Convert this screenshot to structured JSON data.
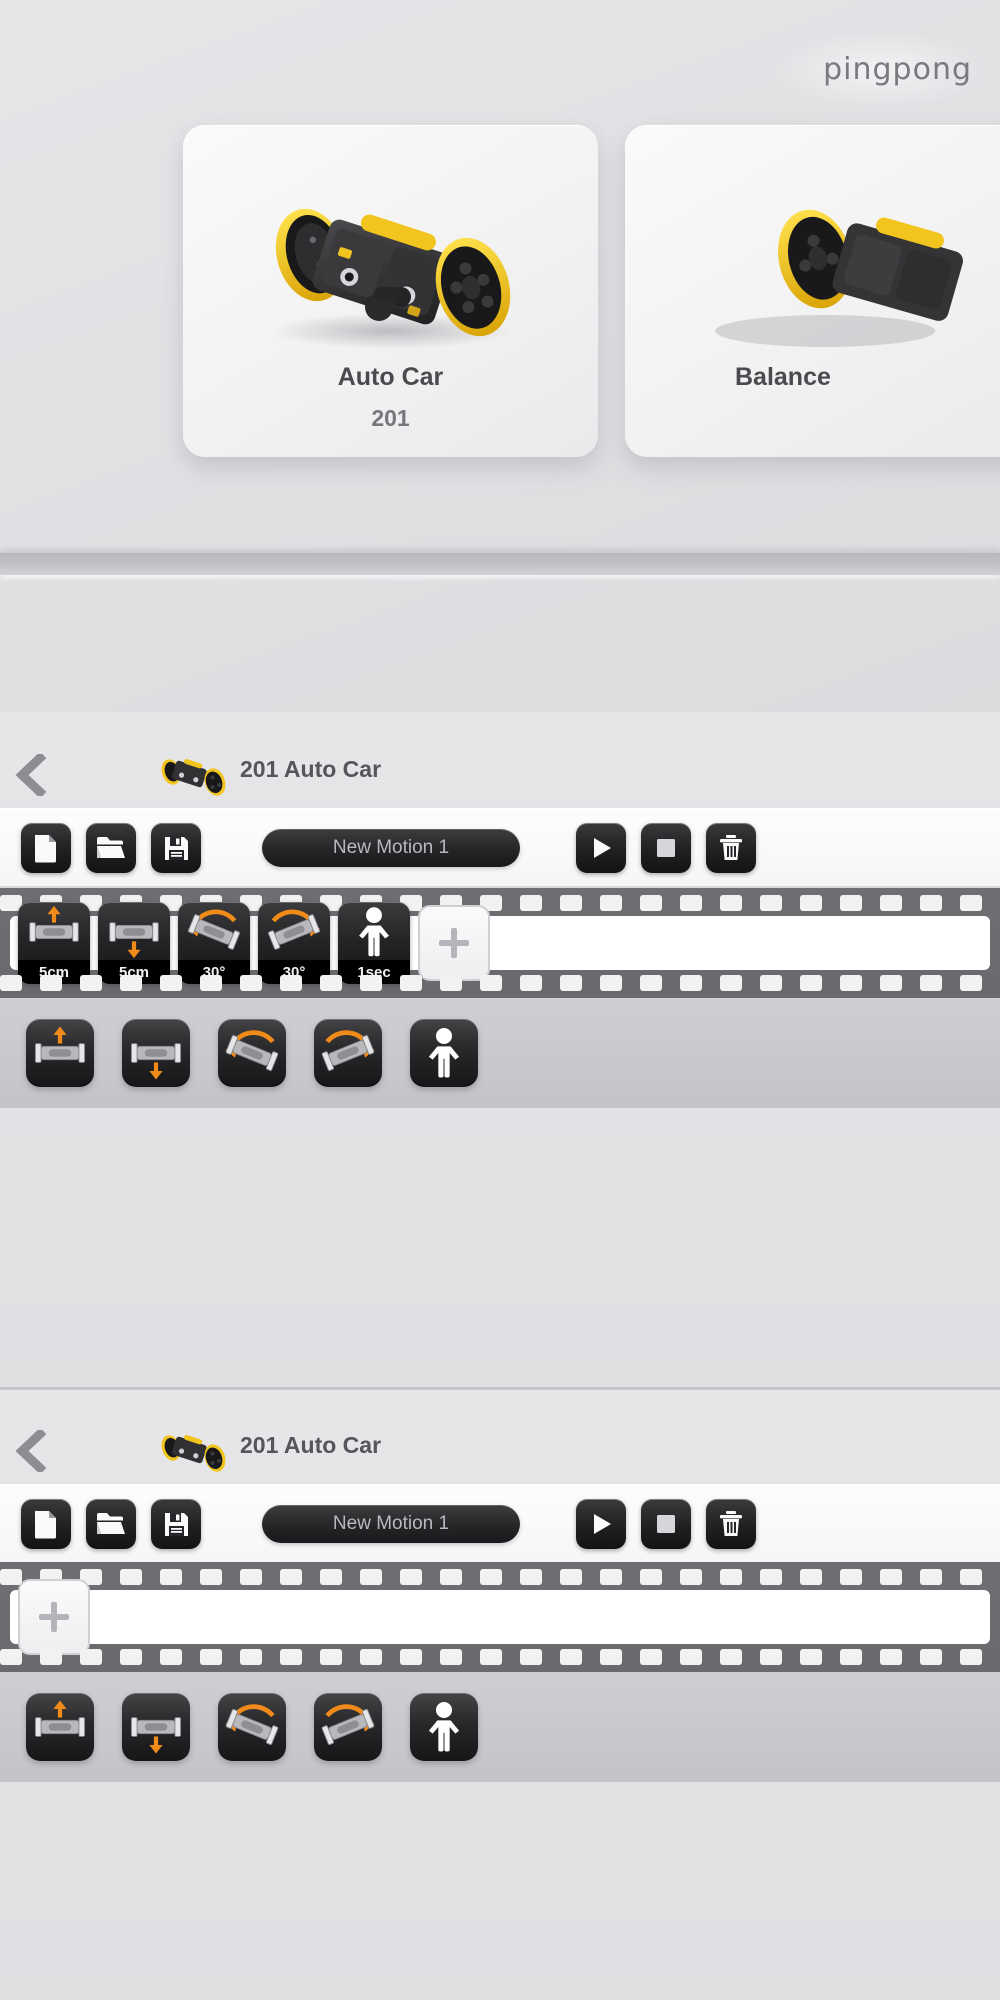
{
  "brand": {
    "name": "pingpong"
  },
  "chooser": {
    "cards": [
      {
        "title": "Auto Car",
        "code": "201",
        "model_icon": "auto-car-robot"
      },
      {
        "title": "Balance",
        "code": "",
        "model_icon": "balance-robot"
      }
    ]
  },
  "editors": [
    {
      "header": {
        "back_icon": "chevron-left-icon",
        "thumb_icon": "auto-car-thumb",
        "title": "201 Auto Car"
      },
      "toolbar": {
        "new_icon": "new-file-icon",
        "open_icon": "open-folder-icon",
        "save_icon": "save-floppy-icon",
        "play_icon": "play-icon",
        "stop_icon": "stop-icon",
        "delete_icon": "trash-icon",
        "motion_name": "New Motion 1",
        "motion_name_placeholder": "New Motion 1"
      },
      "keyframes": [
        {
          "icon": "move-up-icon",
          "label": "5cm"
        },
        {
          "icon": "move-down-icon",
          "label": "5cm"
        },
        {
          "icon": "rotate-left-icon",
          "label": "30°"
        },
        {
          "icon": "rotate-right-icon",
          "label": "30°"
        },
        {
          "icon": "pose-person-icon",
          "label": "1sec"
        }
      ],
      "add_frame_label": "+",
      "palette": [
        {
          "icon": "move-up-icon"
        },
        {
          "icon": "move-down-icon"
        },
        {
          "icon": "rotate-left-icon"
        },
        {
          "icon": "rotate-right-icon"
        },
        {
          "icon": "pose-person-icon"
        }
      ]
    },
    {
      "header": {
        "back_icon": "chevron-left-icon",
        "thumb_icon": "auto-car-thumb",
        "title": "201 Auto Car"
      },
      "toolbar": {
        "new_icon": "new-file-icon",
        "open_icon": "open-folder-icon",
        "save_icon": "save-floppy-icon",
        "play_icon": "play-icon",
        "stop_icon": "stop-icon",
        "delete_icon": "trash-icon",
        "motion_name": "New Motion 1",
        "motion_name_placeholder": "New Motion 1"
      },
      "keyframes": [],
      "add_frame_label": "+",
      "palette": [
        {
          "icon": "move-up-icon"
        },
        {
          "icon": "move-down-icon"
        },
        {
          "icon": "rotate-left-icon"
        },
        {
          "icon": "rotate-right-icon"
        },
        {
          "icon": "pose-person-icon"
        }
      ]
    }
  ],
  "colors": {
    "accent_orange": "#f08a18",
    "robot_yellow": "#f2c51e",
    "robot_black": "#2a2a2c",
    "panel_dark": "#1c1c1e",
    "background": "#e2e2e5"
  }
}
